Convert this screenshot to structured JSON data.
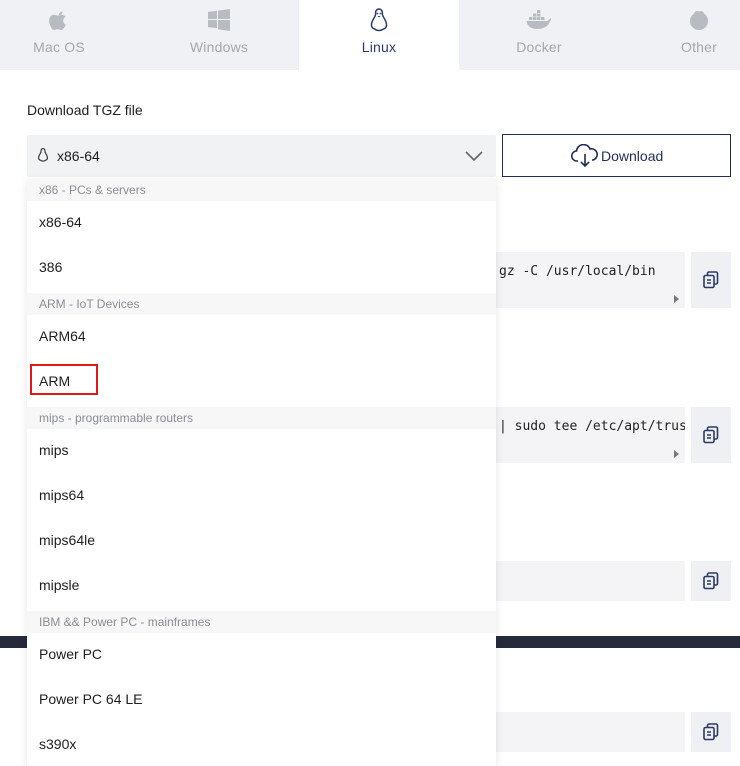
{
  "tabs": [
    {
      "label": "Mac OS",
      "icon": "apple-icon",
      "active": false
    },
    {
      "label": "Windows",
      "icon": "windows-icon",
      "active": false
    },
    {
      "label": "Linux",
      "icon": "linux-icon",
      "active": true
    },
    {
      "label": "Docker",
      "icon": "docker-icon",
      "active": false
    },
    {
      "label": "Other",
      "icon": "other-os-icon",
      "active": false
    }
  ],
  "download": {
    "section_label": "Download TGZ file",
    "selected_arch": "x86-64",
    "button_label": "Download"
  },
  "code_blocks": [
    {
      "visible_text": "gz -C /usr/local/bin"
    },
    {
      "visible_text": "| sudo tee /etc/apt/trus"
    },
    {
      "visible_text": ""
    },
    {
      "visible_text": ""
    }
  ],
  "dropdown": {
    "groups": [
      {
        "label": "x86 - PCs & servers",
        "options": [
          "x86-64",
          "386"
        ]
      },
      {
        "label": "ARM - IoT Devices",
        "options": [
          "ARM64",
          "ARM"
        ]
      },
      {
        "label": "mips - programmable routers",
        "options": [
          "mips",
          "mips64",
          "mips64le",
          "mipsle"
        ]
      },
      {
        "label": "IBM && Power PC - mainframes",
        "options": [
          "Power PC",
          "Power PC 64 LE",
          "s390x"
        ]
      }
    ]
  },
  "colors": {
    "accent": "#1f2d57",
    "tab_bar": "#f0f1f4",
    "highlight": "#e01818",
    "dark_bar": "#272a3a"
  }
}
